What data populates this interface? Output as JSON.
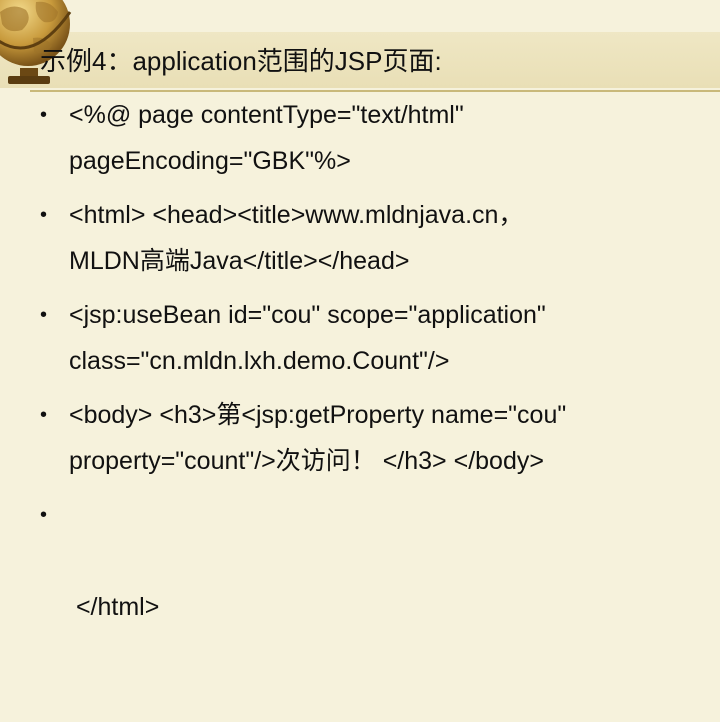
{
  "slide": {
    "title": "示例4：application范围的JSP页面:",
    "bullet_symbol": "•",
    "bullets": [
      {
        "line1": "<%@ page contentType=\"text/html\"",
        "line2": "pageEncoding=\"GBK\"%>"
      },
      {
        "line1": "<html> <head><title>www.mldnjava.cn，",
        "line2": "MLDN高端Java</title></head>"
      },
      {
        "line1": "<jsp:useBean id=\"cou\" scope=\"application\"",
        "line2": "class=\"cn.mldn.lxh.demo.Count\"/>"
      },
      {
        "line1": "<body> <h3>第<jsp:getProperty name=\"cou\"",
        "line2": "property=\"count\"/>次访问！ </h3> </body>"
      },
      {
        "line1": " </html>",
        "line2": ""
      }
    ]
  },
  "decoration": {
    "icon": "globe-icon",
    "colors": {
      "background": "#f6f2dc",
      "title_band": "#ece3bd",
      "rule": "#c9b97a",
      "globe": "#c89a3c"
    }
  }
}
